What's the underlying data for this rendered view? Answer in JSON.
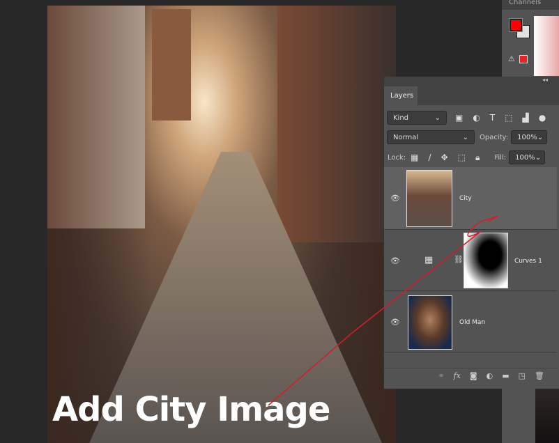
{
  "caption": "Add City Image",
  "right_tabs": "Channels",
  "colors": {
    "foreground": "#ff0000",
    "background": "#e2e2e2",
    "accent_arrow": "#d01f2a"
  },
  "layers_panel": {
    "collapse": "◂◂",
    "tab": "Layers",
    "filter": {
      "label": "Kind",
      "icons": [
        "image-filter-icon",
        "adjustment-filter-icon",
        "type-filter-icon",
        "shape-filter-icon",
        "smart-object-filter-icon"
      ]
    },
    "blend_mode": "Normal",
    "opacity_label": "Opacity:",
    "opacity": "100%",
    "lock_label": "Lock:",
    "fill_label": "Fill:",
    "fill": "100%",
    "layers": [
      {
        "name": "City",
        "selected": true
      },
      {
        "name": "Curves 1"
      },
      {
        "name": "Old Man"
      }
    ],
    "bottom": {
      "fx": "fx"
    }
  }
}
